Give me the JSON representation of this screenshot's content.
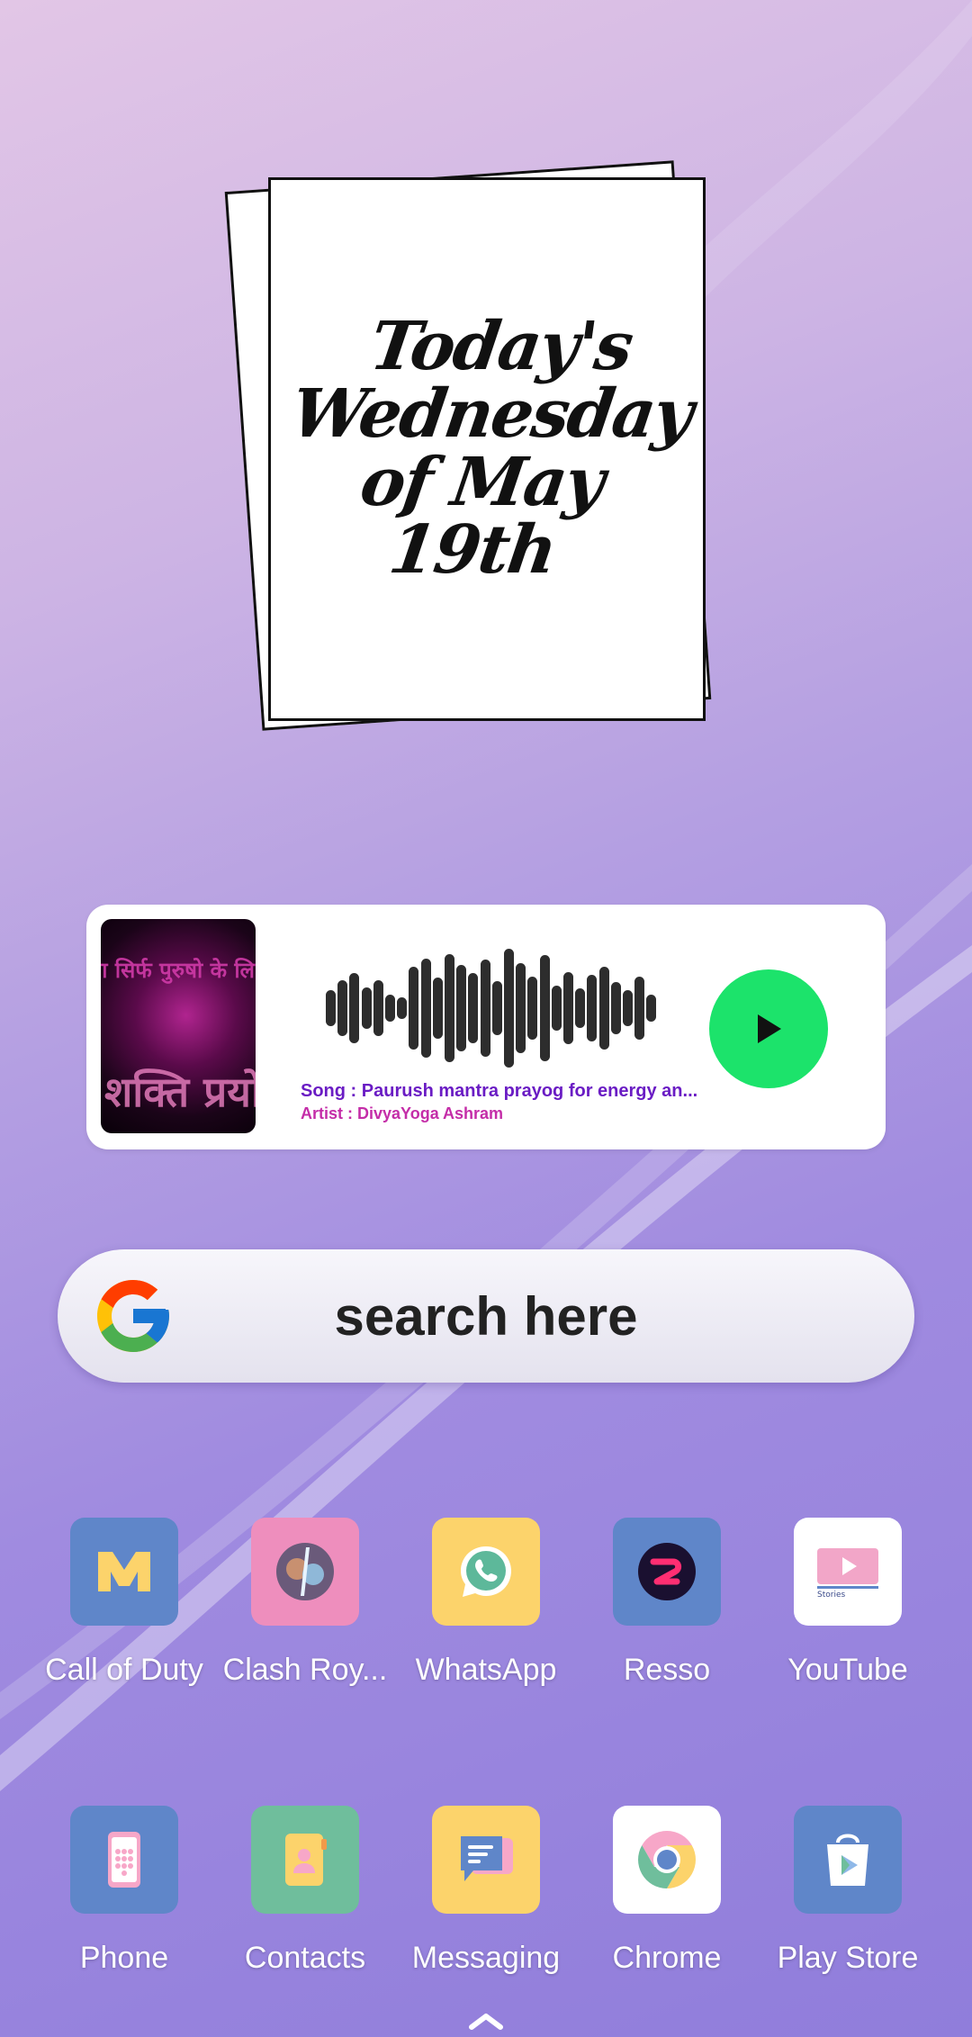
{
  "calendar_widget": {
    "line1": "Today's",
    "line2": "Wednesday",
    "line3": "of May",
    "line4": "19th"
  },
  "music_widget": {
    "album_text_top": "ग सिर्फ पुरुषो के लि",
    "album_text_bottom": "शक्ति प्रयो",
    "song": "Song : Paurush mantra prayog for energy an...",
    "artist": "Artist : DivyaYoga Ashram",
    "play_button_color": "#1ce36b"
  },
  "search": {
    "text": "search here",
    "logo_icon": "google-g-icon"
  },
  "apps_row1": [
    {
      "label": "Call of Duty",
      "icon": "call-of-duty-icon",
      "bg": "#5f86c9"
    },
    {
      "label": "Clash Roy...",
      "icon": "clash-royale-icon",
      "bg": "#ee8ebd"
    },
    {
      "label": "WhatsApp",
      "icon": "whatsapp-icon",
      "bg": "#fcd36b"
    },
    {
      "label": "Resso",
      "icon": "resso-icon",
      "bg": "#5f86c9"
    },
    {
      "label": "YouTube",
      "icon": "youtube-icon",
      "bg": "#ffffff"
    }
  ],
  "apps_row2": [
    {
      "label": "Phone",
      "icon": "phone-icon",
      "bg": "#5f86c9"
    },
    {
      "label": "Contacts",
      "icon": "contacts-icon",
      "bg": "#6fbe9c"
    },
    {
      "label": "Messaging",
      "icon": "messaging-icon",
      "bg": "#fcd36b"
    },
    {
      "label": "Chrome",
      "icon": "chrome-icon",
      "bg": "#ffffff"
    },
    {
      "label": "Play Store",
      "icon": "play-store-icon",
      "bg": "#5f86c9"
    }
  ],
  "youtube_badge": "Stories"
}
